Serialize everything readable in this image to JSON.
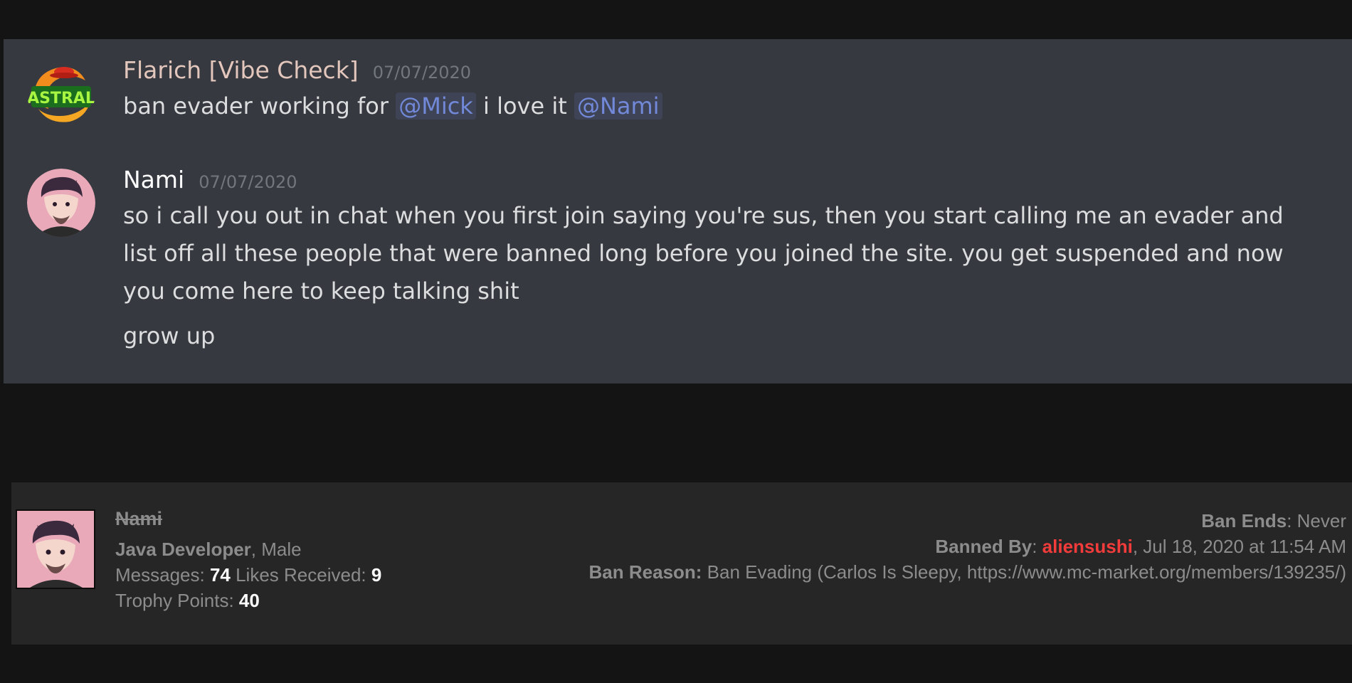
{
  "chat": {
    "messages": [
      {
        "username": "Flarich [Vibe Check]",
        "timestamp": "07/07/2020",
        "avatar_icon": "astral-logo-avatar",
        "text_before": "ban evader working for ",
        "mention1": "@Mick",
        "text_middle": " i love it ",
        "mention2": "@Nami"
      },
      {
        "username": "Nami",
        "timestamp": "07/07/2020",
        "avatar_icon": "anime-boy-avatar",
        "lines": [
          "so i call you out in chat when you first join saying you're sus, then you start calling me an evader and",
          "list off all these people that were banned long before you joined the site. you get suspended and now",
          "you come here to keep talking shit"
        ],
        "follow_up": "grow up"
      }
    ]
  },
  "profile": {
    "name": "Nami",
    "title": "Java Developer",
    "gender_sep": ", Male",
    "messages_label": "Messages: ",
    "messages_value": "74",
    "likes_label": " Likes Received: ",
    "likes_value": "9",
    "trophy_label": "Trophy Points: ",
    "trophy_value": "40"
  },
  "ban": {
    "ends_label": "Ban Ends",
    "ends_value": ": Never",
    "banned_by_label": "Banned By",
    "banned_by_colon": ": ",
    "banned_by_user": "aliensushi",
    "banned_at": ", Jul 18, 2020 at 11:54 AM",
    "reason_label": "Ban Reason:",
    "reason_value": " Ban Evading (Carlos Is Sleepy, https://www.mc-market.org/members/139235/)"
  },
  "colors": {
    "page_bg": "#141414",
    "chat_bg": "#36393f",
    "mention": "#7289da",
    "profile_bg": "#262626",
    "banner_red": "#f23b3b"
  }
}
